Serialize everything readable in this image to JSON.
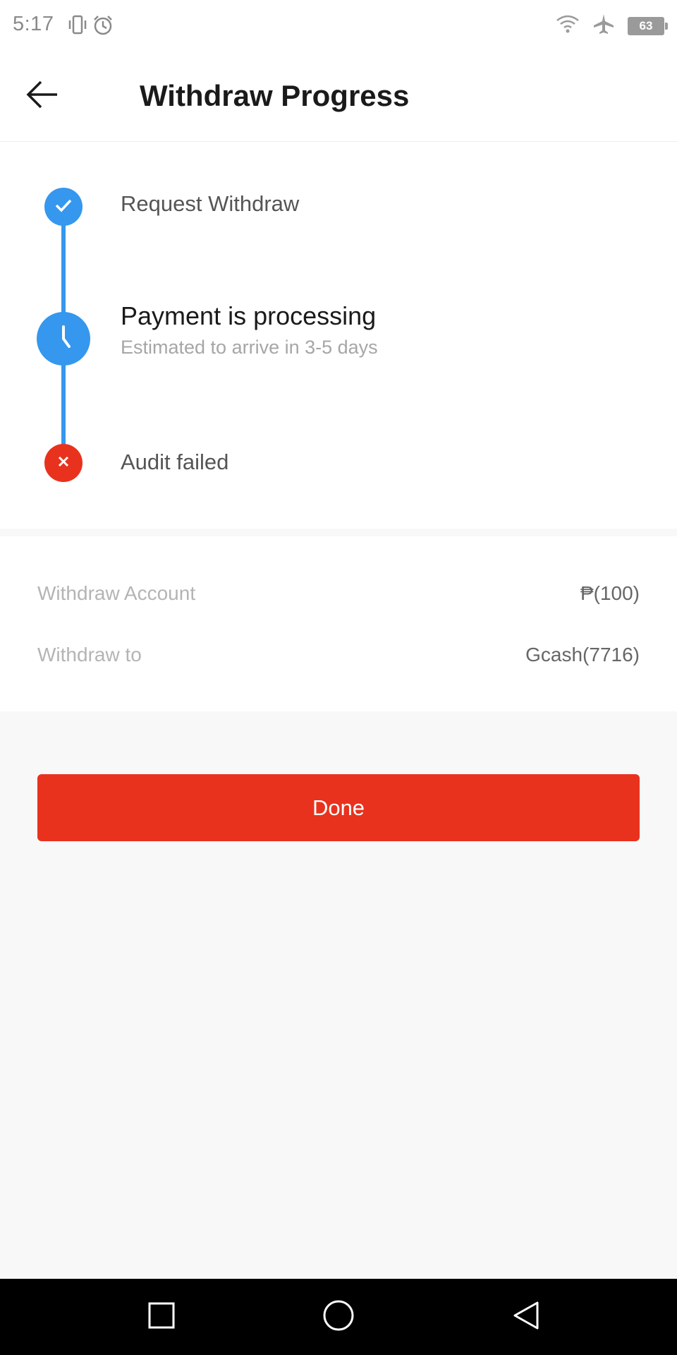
{
  "status_bar": {
    "time": "5:17",
    "battery_level": "63",
    "icons": [
      "vibrate-icon",
      "alarm-icon",
      "wifi-icon",
      "airplane-icon",
      "battery-icon"
    ]
  },
  "header": {
    "title": "Withdraw Progress",
    "back_icon": "back-arrow-icon"
  },
  "progress": {
    "steps": [
      {
        "label": "Request Withdraw",
        "status": "done",
        "icon": "check-icon"
      },
      {
        "label": "Payment is processing",
        "sublabel": "Estimated to arrive in 3-5 days",
        "status": "current",
        "icon": "clock-icon"
      },
      {
        "label": "Audit failed",
        "status": "failed",
        "icon": "close-icon"
      }
    ]
  },
  "details": {
    "account_label": "Withdraw Account",
    "account_value": "₱(100)",
    "to_label": "Withdraw to",
    "to_value": "Gcash(7716)"
  },
  "actions": {
    "done_label": "Done"
  },
  "nav_bar": {
    "icons": [
      "recents-icon",
      "home-icon",
      "back-triangle-icon"
    ]
  },
  "colors": {
    "accent_blue": "#3597ee",
    "accent_red": "#e8321e",
    "background": "#f8f8f8"
  }
}
